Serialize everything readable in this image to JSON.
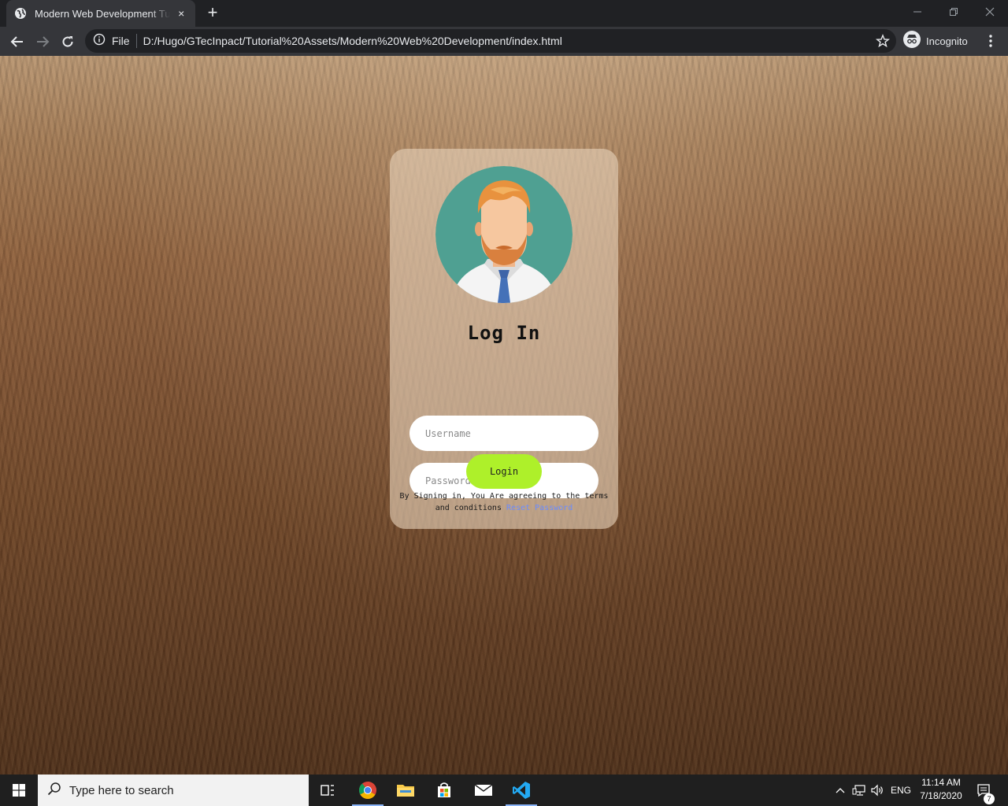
{
  "browser": {
    "tab_title": "Modern Web Development Tutorial",
    "tab_close": "×",
    "new_tab": "+",
    "address_scheme_label": "File",
    "address_url": "D:/Hugo/GTecInpact/Tutorial%20Assets/Modern%20Web%20Development/index.html",
    "profile_label": "Incognito",
    "icons": [
      "globe-icon",
      "close-icon",
      "plus-icon",
      "minimize-icon",
      "restore-icon",
      "window-close-icon",
      "back-arrow-icon",
      "forward-arrow-icon",
      "reload-icon",
      "info-icon",
      "star-icon",
      "incognito-icon",
      "kebab-menu-icon"
    ]
  },
  "login_card": {
    "title": "Log In",
    "username_placeholder": "Username",
    "password_placeholder": "Password",
    "login_button": "Login",
    "terms_text": "By Signing in, You Are agreeing to the terms and conditions",
    "reset_link": "Reset Password",
    "colors": {
      "button": "#aef02a",
      "link": "#6b8cff",
      "avatar_bg": "#4fa092"
    }
  },
  "taskbar": {
    "search_placeholder": "Type here to search",
    "language": "ENG",
    "time": "11:14 AM",
    "date": "7/18/2020",
    "notification_count": "7",
    "apps": [
      "task-view-icon",
      "chrome-icon",
      "file-explorer-icon",
      "store-icon",
      "mail-icon",
      "vscode-icon"
    ]
  }
}
